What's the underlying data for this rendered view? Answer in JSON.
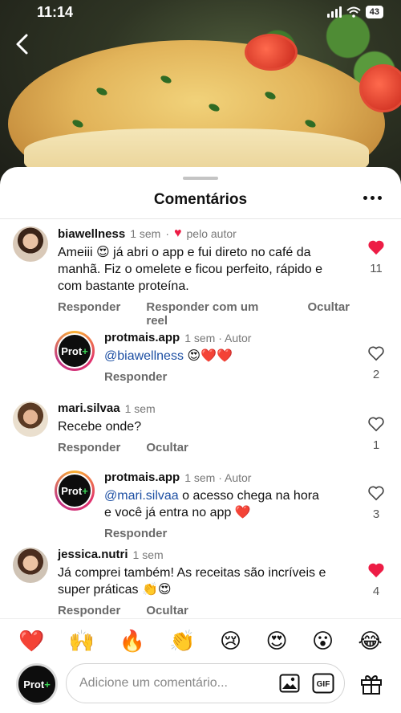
{
  "status": {
    "time": "11:14",
    "battery": "43"
  },
  "sheet": {
    "title": "Comentários"
  },
  "comments": [
    {
      "user": "biawellness",
      "time": "1 sem",
      "dot": "·",
      "by_author": "pelo autor",
      "text": "Ameiii 😍 já abri o app e fui direto no café da manhã.  Fiz o omelete e ficou perfeito, rápido e com bastante proteína.",
      "actions": [
        "Responder",
        "Responder com um reel",
        "Ocultar"
      ],
      "likes": "11"
    },
    {
      "user": "protmais.app",
      "time": "1 sem · Autor",
      "mention": "@biawellness",
      "text": " 😍❤️❤️",
      "actions": [
        "Responder"
      ],
      "likes": "2"
    },
    {
      "user": "mari.silvaa",
      "time": "1 sem",
      "text": "Recebe onde?",
      "actions": [
        "Responder",
        "Ocultar"
      ],
      "likes": "1"
    },
    {
      "user": "protmais.app",
      "time": "1 sem · Autor",
      "mention": "@mari.silvaa",
      "text": " o acesso chega na hora e você já entra no app ❤️",
      "actions": [
        "Responder"
      ],
      "likes": "3"
    },
    {
      "user": "jessica.nutri",
      "time": "1 sem",
      "text": "Já comprei também! As receitas são incríveis e super práticas 👏😍",
      "actions": [
        "Responder",
        "Ocultar"
      ],
      "likes": "4"
    }
  ],
  "brand": {
    "logo_text": "Prot",
    "logo_plus": "+"
  },
  "emoji_bar": [
    "❤️",
    "🙌",
    "🔥",
    "👏",
    "😢",
    "😍",
    "😮",
    "😂"
  ],
  "composer": {
    "placeholder": "Adicione um comentário...",
    "gif": "GIF"
  },
  "colors": {
    "like_active": "#ed1c45",
    "mention": "#1d4fa3",
    "brand_green": "#39d353"
  }
}
